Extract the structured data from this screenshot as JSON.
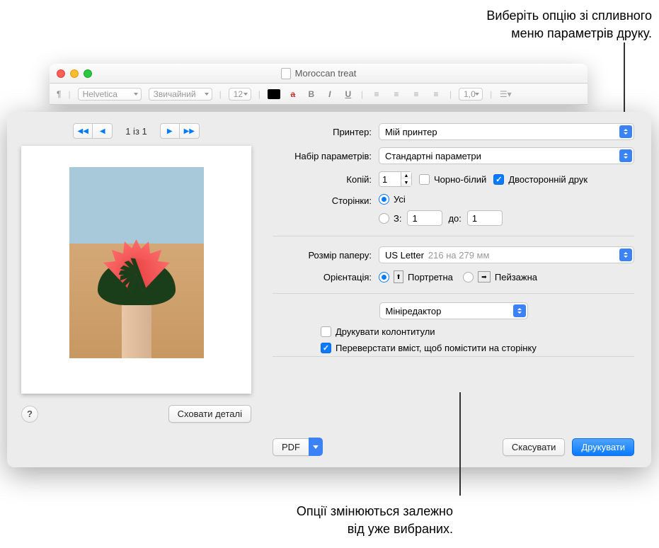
{
  "callouts": {
    "top_line1": "Виберіть опцію зі спливного",
    "top_line2": "меню параметрів друку.",
    "bottom_line1": "Опції змінюються залежно",
    "bottom_line2": "від уже вибраних."
  },
  "window": {
    "title": "Moroccan treat"
  },
  "toolbar": {
    "font": "Helvetica",
    "style": "Звичайний",
    "size": "12",
    "line_spacing": "1,0"
  },
  "sheet": {
    "page_counter": "1 із 1",
    "hide_details": "Сховати деталі",
    "pdf_label": "PDF",
    "labels": {
      "printer": "Принтер:",
      "presets": "Набір параметрів:",
      "copies": "Копій:",
      "bw": "Чорно-білий",
      "duplex": "Двосторонній друк",
      "pages": "Сторінки:",
      "all": "Усі",
      "from": "З:",
      "to": "до:",
      "paper_size": "Розмір паперу:",
      "orientation": "Орієнтація:",
      "portrait": "Портретна",
      "landscape": "Пейзажна"
    },
    "values": {
      "printer": "Мій принтер",
      "presets": "Стандартні параметри",
      "copies": "1",
      "from": "1",
      "to": "1",
      "paper_name": "US Letter",
      "paper_dim": "216 на 279 мм"
    },
    "mini": {
      "title": "Мініредактор",
      "headers_footers": "Друкувати колонтитули",
      "rewrap": "Переверстати вміст, щоб помістити на сторінку"
    },
    "footer": {
      "cancel": "Скасувати",
      "print": "Друкувати"
    }
  }
}
